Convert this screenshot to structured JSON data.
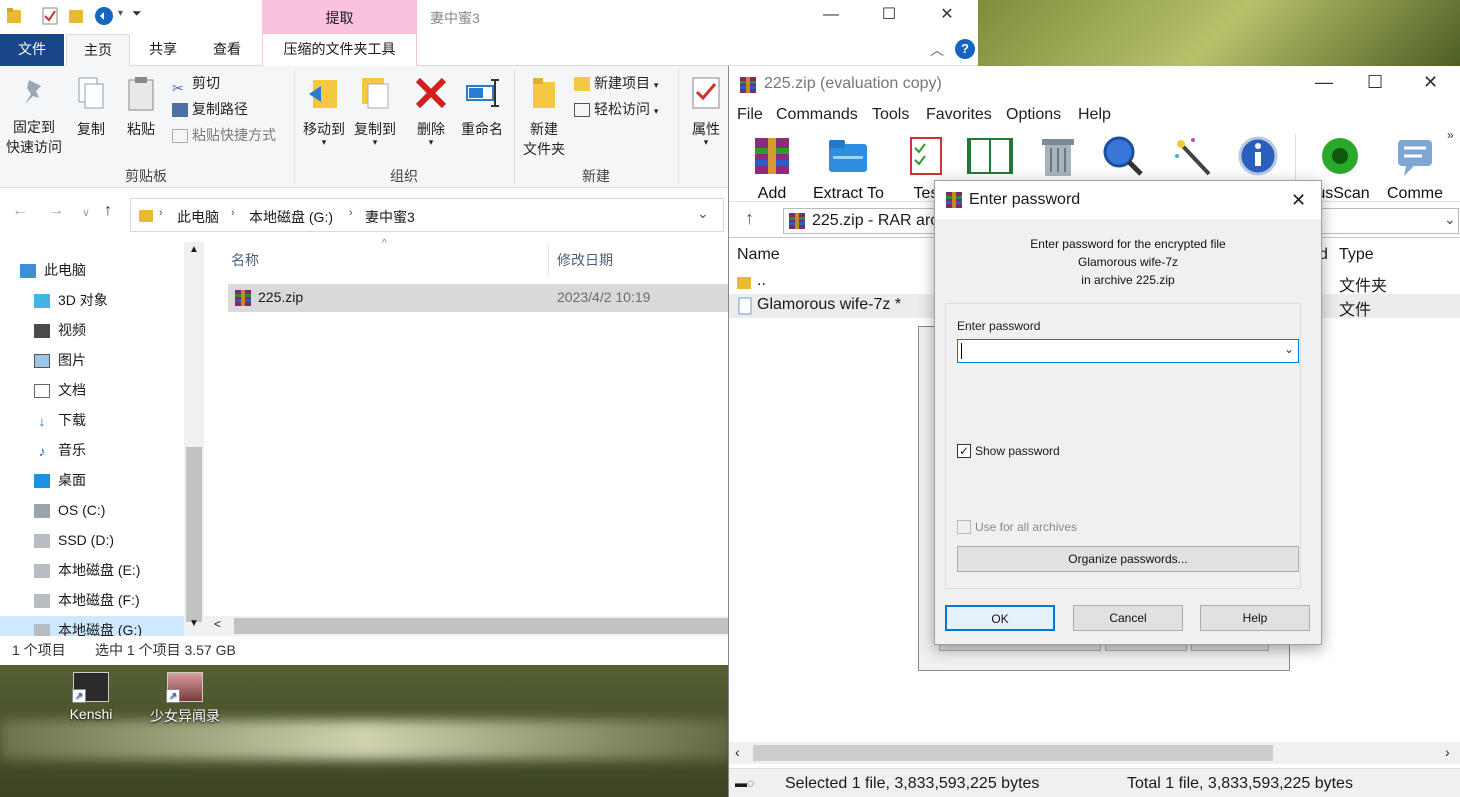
{
  "explorer": {
    "title": "妻中蜜3",
    "context_tab": "提取",
    "tabs": [
      "文件",
      "主页",
      "共享",
      "查看",
      "压缩的文件夹工具"
    ],
    "ribbon": {
      "pin": "固定到\n快速访问",
      "pin_l1": "固定到",
      "pin_l2": "快速访问",
      "copy": "复制",
      "paste": "粘贴",
      "cut": "剪切",
      "copy_path": "复制路径",
      "paste_shortcut": "粘贴快捷方式",
      "clipboard_group": "剪贴板",
      "move_to": "移动到",
      "copy_to": "复制到",
      "delete": "删除",
      "rename": "重命名",
      "organize_group": "组织",
      "new_folder_l1": "新建",
      "new_folder_l2": "文件夹",
      "new_item": "新建项目",
      "easy_access": "轻松访问",
      "new_group": "新建",
      "properties": "属性"
    },
    "breadcrumb": [
      "此电脑",
      "本地磁盘 (G:)",
      "妻中蜜3"
    ],
    "nav": [
      "此电脑",
      "3D 对象",
      "视频",
      "图片",
      "文档",
      "下载",
      "音乐",
      "桌面",
      "OS (C:)",
      "SSD (D:)",
      "本地磁盘 (E:)",
      "本地磁盘 (F:)",
      "本地磁盘 (G:)"
    ],
    "columns": {
      "name": "名称",
      "date": "修改日期"
    },
    "files": [
      {
        "name": "225.zip",
        "date": "2023/4/2 10:19"
      }
    ],
    "status": {
      "count": "1 个项目",
      "selected": "选中 1 个项目  3.57 GB"
    }
  },
  "desktop_icons": [
    {
      "label": "Kenshi"
    },
    {
      "label": "少女异闻录"
    }
  ],
  "winrar": {
    "title": "225.zip (evaluation copy)",
    "menu": [
      "File",
      "Commands",
      "Tools",
      "Favorites",
      "Options",
      "Help"
    ],
    "toolbar": [
      "Add",
      "Extract To",
      "Tes",
      "rusScan",
      "Comme"
    ],
    "path": "225.zip - RAR arc",
    "columns": {
      "name": "Name",
      "type": "Type",
      "d": "d"
    },
    "rows": [
      {
        "name": "..",
        "type": "文件夹"
      },
      {
        "name": "Glamorous wife-7z *",
        "type": "文件"
      }
    ],
    "status": {
      "selected": "Selected 1 file, 3,833,593,225 bytes",
      "total": "Total 1 file, 3,833,593,225 bytes"
    }
  },
  "dialog": {
    "title": "Enter password",
    "msg1": "Enter password for the encrypted file",
    "msg2": "Glamorous wife-7z",
    "msg3": "in archive 225.zip",
    "field_label": "Enter password",
    "password_value": "",
    "show_password": "Show password",
    "use_all": "Use for all archives",
    "organize": "Organize passwords...",
    "ok": "OK",
    "cancel": "Cancel",
    "help": "Help"
  },
  "colors": {
    "file_tab": "#19478a",
    "context_tab": "#f9c2de",
    "selection": "#cde8ff",
    "focus_border": "#0078d7"
  }
}
